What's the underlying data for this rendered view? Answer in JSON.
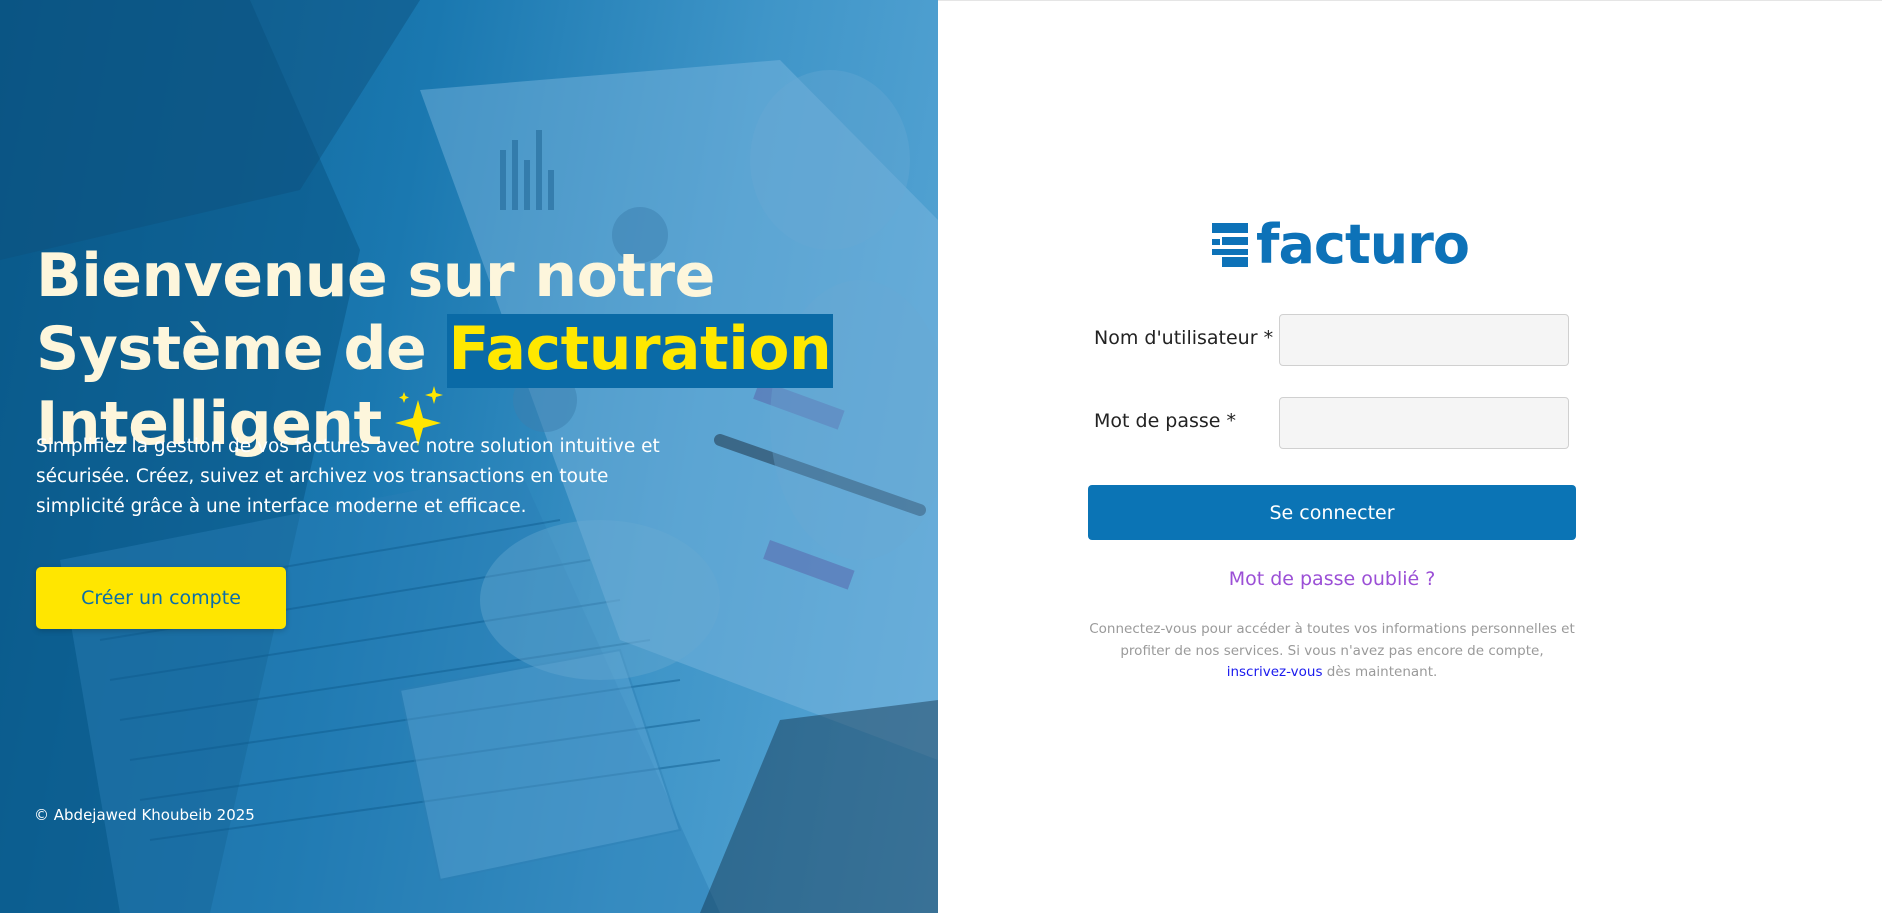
{
  "hero": {
    "title_part1": "Bienvenue sur notre Système de",
    "title_highlight": "Facturation",
    "title_part2": "Intelligent",
    "description": "Simplifiez la gestion de vos factures avec notre solution intuitive et sécurisée. Créez, suivez et archivez vos transactions en toute simplicité grâce à une interface moderne et efficace.",
    "cta_label": "Créer un compte",
    "copyright": "© Abdejawed Khoubeib 2025"
  },
  "login": {
    "logo_text": "facturo",
    "username_label": "Nom d'utilisateur *",
    "username_value": "",
    "password_label": "Mot de passe *",
    "password_value": "",
    "submit_label": "Se connecter",
    "forgot_label": "Mot de passe oublié ?",
    "help_text": "Connectez-vous pour accéder à toutes vos informations personnelles et profiter de nos services. Si vous n'avez pas encore de compte,",
    "signup_link": "inscrivez-vous",
    "help_text_end": "dès maintenant."
  },
  "colors": {
    "brand_blue": "#0b74b5",
    "accent_yellow": "#ffe600",
    "forgot_purple": "#9b4fd6",
    "link_blue": "#1a1aee"
  },
  "icons": {
    "sparkles": "sparkles-icon",
    "logo": "facturo-logo-icon"
  }
}
